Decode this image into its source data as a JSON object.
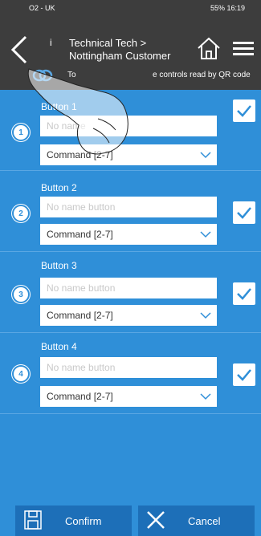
{
  "status_bar": {
    "carrier": "O2 - UK",
    "battery": "55%",
    "time": "16:19"
  },
  "header": {
    "title_prefix": "i",
    "title_line1": "Technical Tech >",
    "title_line2": "Nottingham Customer",
    "sub_text_a": "To",
    "sub_text_b": "e controls read by QR code"
  },
  "buttons": [
    {
      "number": "1",
      "label": "Button 1",
      "name_placeholder": "No name",
      "command": "Command [2-7]",
      "checked": true
    },
    {
      "number": "2",
      "label": "Button 2",
      "name_placeholder": "No name button",
      "command": "Command [2-7]",
      "checked": true
    },
    {
      "number": "3",
      "label": "Button 3",
      "name_placeholder": "No name button",
      "command": "Command [2-7]",
      "checked": true
    },
    {
      "number": "4",
      "label": "Button 4",
      "name_placeholder": "No name button",
      "command": "Command [2-7]",
      "checked": true
    }
  ],
  "footer": {
    "confirm_label": "Confirm",
    "cancel_label": "Cancel"
  },
  "colors": {
    "primary": "#2f8fd8",
    "header_bg": "#3d3d3d",
    "footer_button": "#1d6fb8"
  }
}
